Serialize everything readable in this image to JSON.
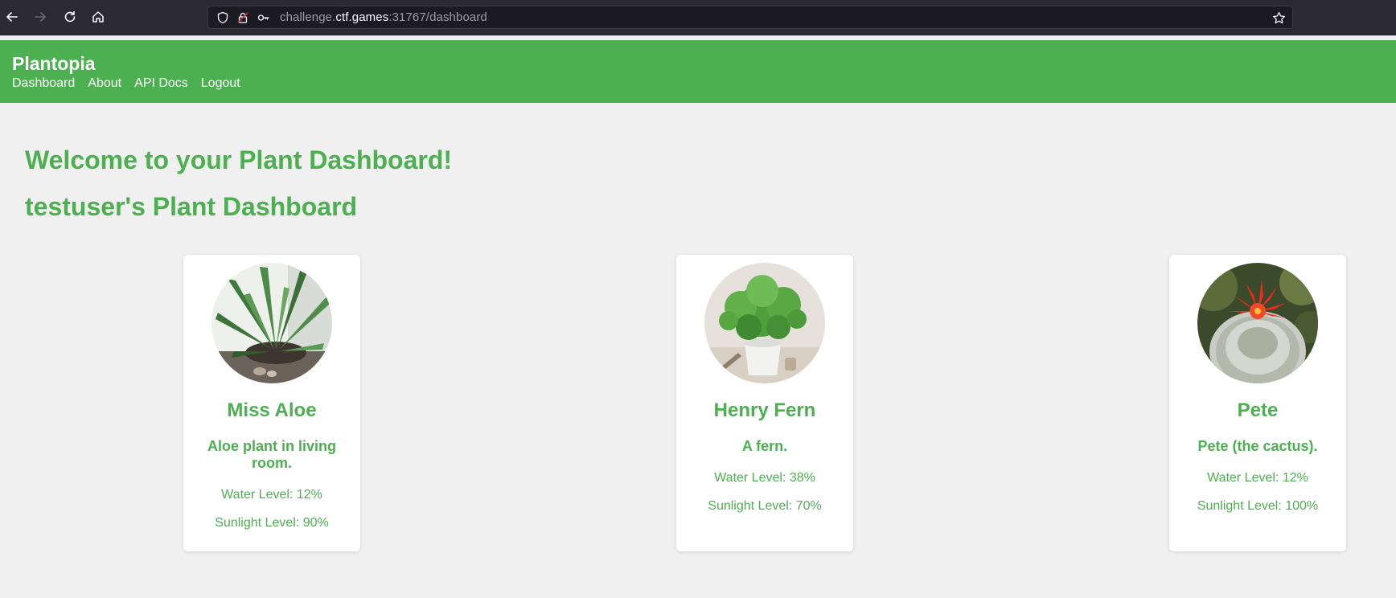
{
  "browser": {
    "url_prefix": "challenge.",
    "url_host": "ctf.games",
    "url_rest": ":31767/dashboard"
  },
  "header": {
    "brand": "Plantopia",
    "nav": [
      "Dashboard",
      "About",
      "API Docs",
      "Logout"
    ]
  },
  "main": {
    "welcome": "Welcome to your Plant Dashboard!",
    "subtitle": "testuser's Plant Dashboard"
  },
  "plants": [
    {
      "name": "Miss Aloe",
      "description": "Aloe plant in living room.",
      "water": "Water Level: 12%",
      "sunlight": "Sunlight Level: 90%"
    },
    {
      "name": "Henry Fern",
      "description": "A fern.",
      "water": "Water Level: 38%",
      "sunlight": "Sunlight Level: 70%"
    },
    {
      "name": "Pete",
      "description": "Pete (the cactus).",
      "water": "Water Level: 12%",
      "sunlight": "Sunlight Level: 100%"
    }
  ],
  "colors": {
    "accent": "#4caf50",
    "background": "#f0f0f0",
    "browser_chrome": "#2b2a33"
  }
}
